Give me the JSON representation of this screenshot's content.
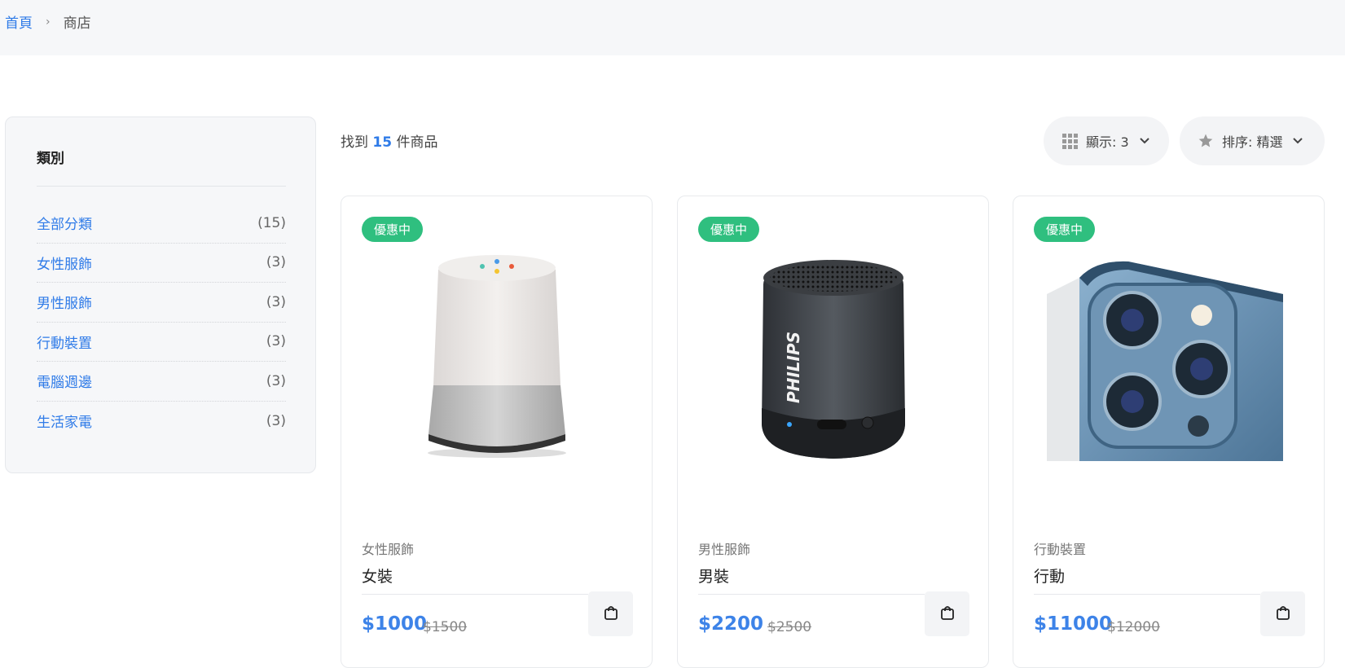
{
  "breadcrumb": {
    "home": "首頁",
    "separator": "›",
    "current": "商店"
  },
  "sidebar": {
    "title": "類別",
    "categories": [
      {
        "name": "全部分類",
        "count": "(15)"
      },
      {
        "name": "女性服飾",
        "count": "(3)"
      },
      {
        "name": "男性服飾",
        "count": "(3)"
      },
      {
        "name": "行動裝置",
        "count": "(3)"
      },
      {
        "name": "電腦週邊",
        "count": "(3)"
      },
      {
        "name": "生活家電",
        "count": "(3)"
      }
    ]
  },
  "results": {
    "prefix": "找到",
    "count": "15",
    "suffix": "件商品"
  },
  "controls": {
    "show_label": "顯示: 3",
    "show_icon": "grid-icon",
    "sort_label": "排序: 精選",
    "sort_icon": "star-icon"
  },
  "products": [
    {
      "badge": "優惠中",
      "category": "女性服飾",
      "name": "女裝",
      "price": "$1000",
      "old_price": "$1500",
      "image": "smart-speaker"
    },
    {
      "badge": "優惠中",
      "category": "男性服飾",
      "name": "男裝",
      "price": "$2200",
      "old_price": "$2500",
      "image": "bluetooth-speaker",
      "image_text": "PHILIPS"
    },
    {
      "badge": "優惠中",
      "category": "行動裝置",
      "name": "行動",
      "price": "$11000",
      "old_price": "$12000",
      "image": "phone-camera"
    }
  ],
  "colors": {
    "accent": "#2f7be8",
    "badge": "#2fbf7f",
    "panel": "#f6f7f9"
  }
}
